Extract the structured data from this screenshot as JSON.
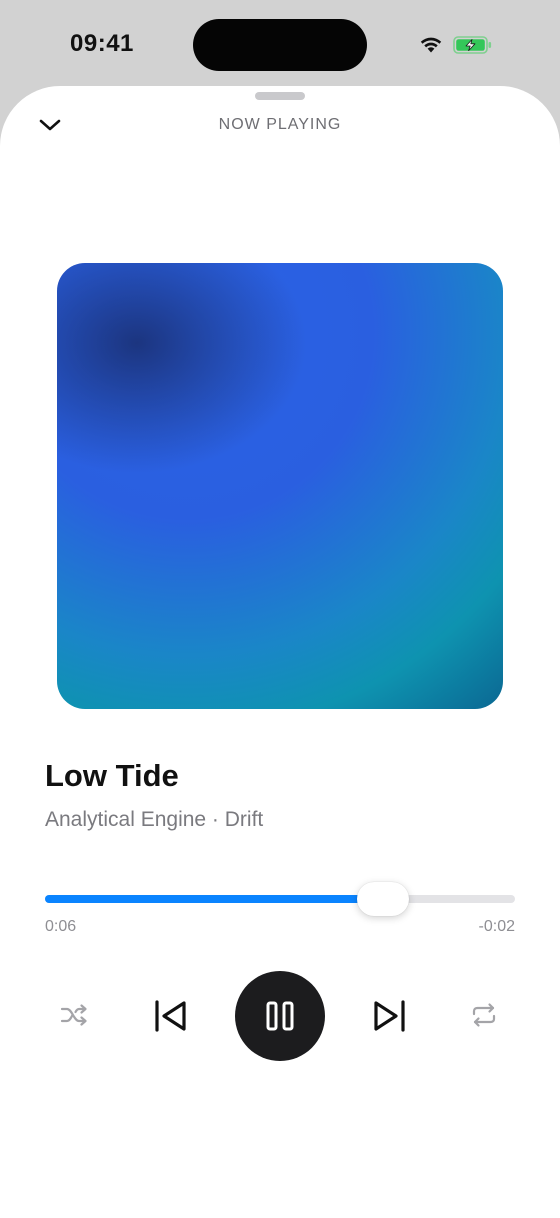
{
  "status_bar": {
    "time": "09:41",
    "wifi_icon": "wifi-icon",
    "battery_icon": "battery-charging-icon",
    "battery_color": "#34c759"
  },
  "sheet": {
    "title": "NOW PLAYING",
    "dismiss_icon": "chevron-down-icon"
  },
  "track": {
    "title": "Low Tide",
    "subtitle": "Analytical Engine · Drift"
  },
  "progress": {
    "elapsed": "0:06",
    "remaining": "-0:02",
    "fraction": 0.72,
    "accent_color": "#0a84ff"
  },
  "controls": {
    "shuffle_icon": "shuffle-icon",
    "previous_icon": "skip-back-icon",
    "pause_icon": "pause-icon",
    "next_icon": "skip-forward-icon",
    "repeat_icon": "repeat-icon"
  }
}
